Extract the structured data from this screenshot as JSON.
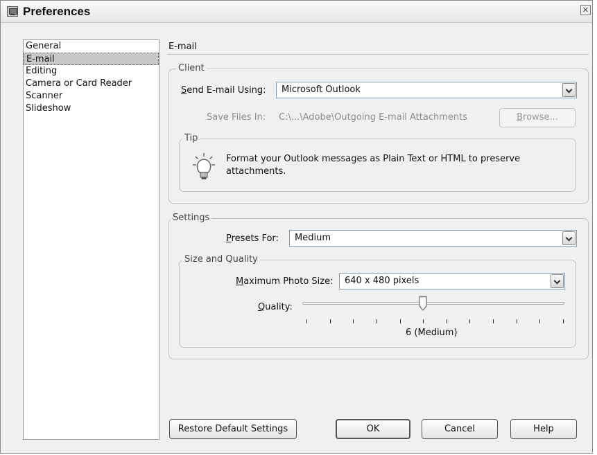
{
  "window": {
    "title": "Preferences",
    "close_glyph": "✕"
  },
  "categories": [
    {
      "label": "General",
      "selected": false
    },
    {
      "label": "E-mail",
      "selected": true
    },
    {
      "label": "Editing",
      "selected": false
    },
    {
      "label": "Camera or Card Reader",
      "selected": false
    },
    {
      "label": "Scanner",
      "selected": false
    },
    {
      "label": "Slideshow",
      "selected": false
    }
  ],
  "panel": {
    "header": "E-mail",
    "client": {
      "legend": "Client",
      "send_using_label_key": "S",
      "send_using_label_rest": "end E-mail Using:",
      "send_using_value": "Microsoft Outlook",
      "save_files_label": "Save Files In:",
      "save_files_value": "C:\\...\\Adobe\\Outgoing E-mail Attachments",
      "browse_key": "B",
      "browse_rest": "rowse..."
    },
    "tip": {
      "legend": "Tip",
      "icon": "lightbulb-icon",
      "text": "Format your Outlook messages as Plain Text or HTML to preserve attachments."
    },
    "settings": {
      "legend": "Settings",
      "presets_label_key": "P",
      "presets_label_rest": "resets For:",
      "presets_value": "Medium",
      "size_quality": {
        "legend": "Size and Quality",
        "max_size_label_key": "M",
        "max_size_label_rest": "aximum Photo Size:",
        "max_size_value": "640 x 480 pixels",
        "quality_label_key": "Q",
        "quality_label_rest": "uality:",
        "quality_value": 6,
        "quality_min": 1,
        "quality_max": 12,
        "quality_text": "6 (Medium)"
      }
    }
  },
  "buttons": {
    "restore": "Restore Default Settings",
    "ok": "OK",
    "cancel": "Cancel",
    "help": "Help"
  }
}
